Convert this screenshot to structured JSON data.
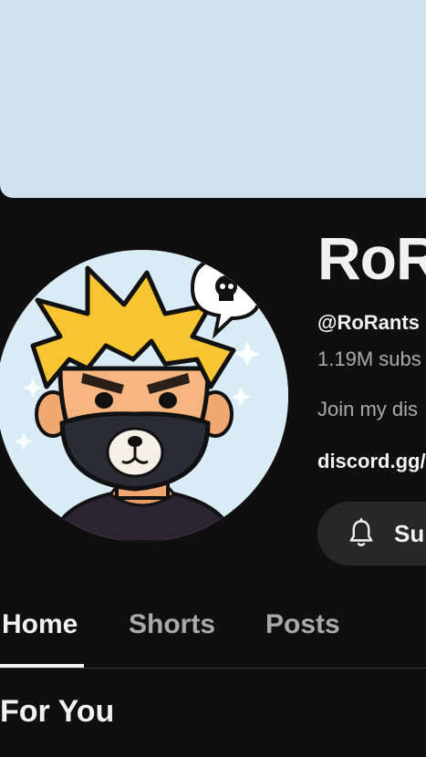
{
  "banner": {
    "color": "#cfe2ee"
  },
  "channel": {
    "name": "RoR",
    "handle": "@RoRants",
    "subscribers": "1.19M subs",
    "description": "Join my dis",
    "link": "discord.gg/"
  },
  "subscribe": {
    "label": "Sub",
    "icon": "bell-icon"
  },
  "tabs": [
    {
      "label": "Home",
      "active": true
    },
    {
      "label": "Shorts",
      "active": false
    },
    {
      "label": "Posts",
      "active": false
    }
  ],
  "section": {
    "title": "For You"
  },
  "colors": {
    "background": "#0f0f0f",
    "text_primary": "#f1f1f1",
    "text_secondary": "#aaaaaa",
    "button_bg": "#272727",
    "avatar_hair": "#f6c531",
    "avatar_mask": "#2b2b35"
  }
}
